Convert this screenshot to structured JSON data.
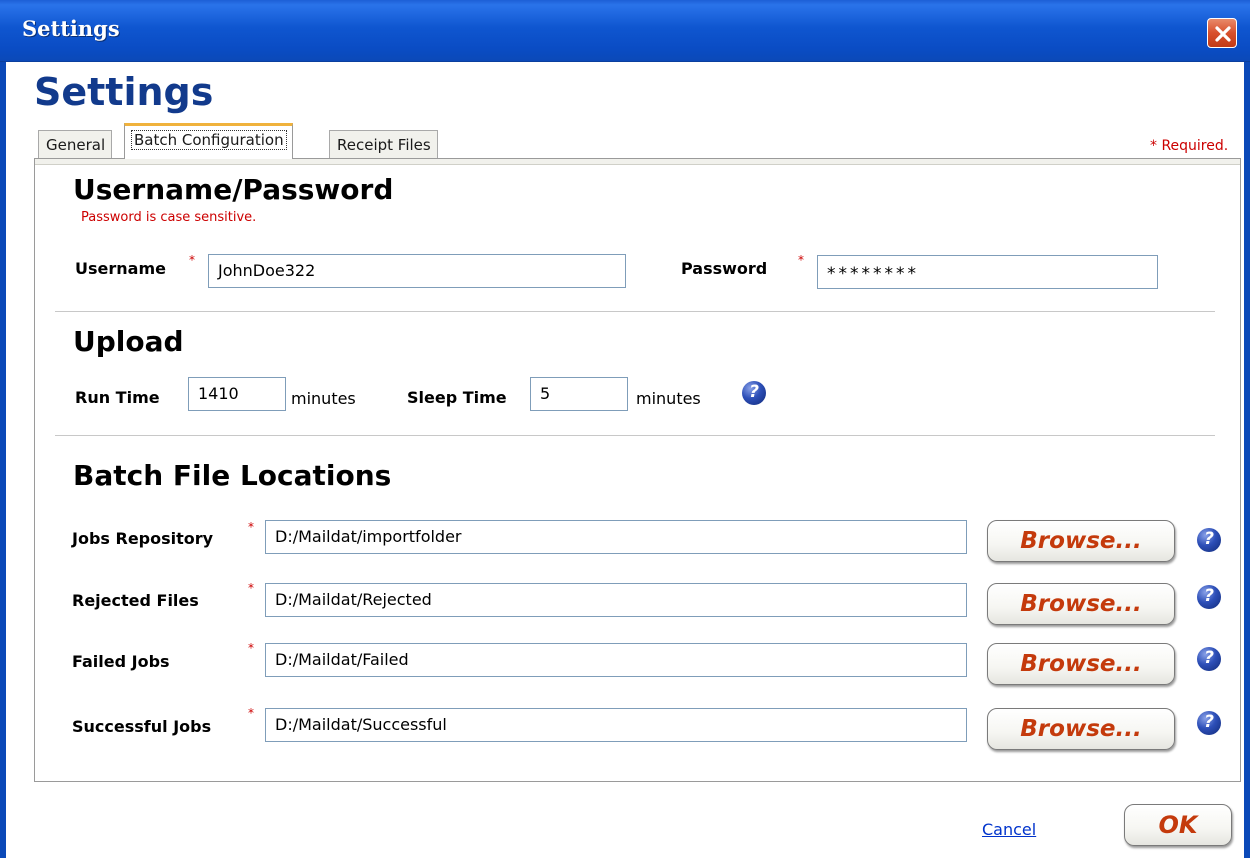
{
  "window": {
    "title": "Settings",
    "close_icon": "close-icon"
  },
  "page_title": "Settings",
  "tabs": [
    {
      "label": "General",
      "active": false
    },
    {
      "label": "Batch Configuration",
      "active": true
    },
    {
      "label": "Receipt Files",
      "active": false
    }
  ],
  "required_note": "* Required.",
  "credentials": {
    "heading": "Username/Password",
    "case_note": "Password is case sensitive.",
    "username_label": "Username",
    "username_value": "JohnDoe322",
    "password_label": "Password",
    "password_value": "********",
    "required_mark": "*"
  },
  "upload": {
    "heading": "Upload",
    "run_time_label": "Run Time",
    "run_time_value": "1410",
    "run_time_unit": "minutes",
    "sleep_time_label": "Sleep Time",
    "sleep_time_value": "5",
    "sleep_time_unit": "minutes",
    "help_icon": "help-icon",
    "help_glyph": "?"
  },
  "locations": {
    "heading": "Batch File Locations",
    "browse_label": "Browse...",
    "rows": [
      {
        "label": "Jobs Repository",
        "value": "D:/Maildat/importfolder"
      },
      {
        "label": "Rejected Files",
        "value": "D:/Maildat/Rejected"
      },
      {
        "label": "Failed Jobs",
        "value": "D:/Maildat/Failed"
      },
      {
        "label": "Successful Jobs",
        "value": "D:/Maildat/Successful"
      }
    ]
  },
  "footer": {
    "cancel_label": "Cancel",
    "ok_label": "OK"
  },
  "colors": {
    "titlebar": "#0b49b8",
    "page_title": "#123a8c",
    "required": "#cc0000",
    "button_text": "#c43a0c",
    "link": "#0033cc",
    "active_tab_accent": "#f0b23c"
  }
}
